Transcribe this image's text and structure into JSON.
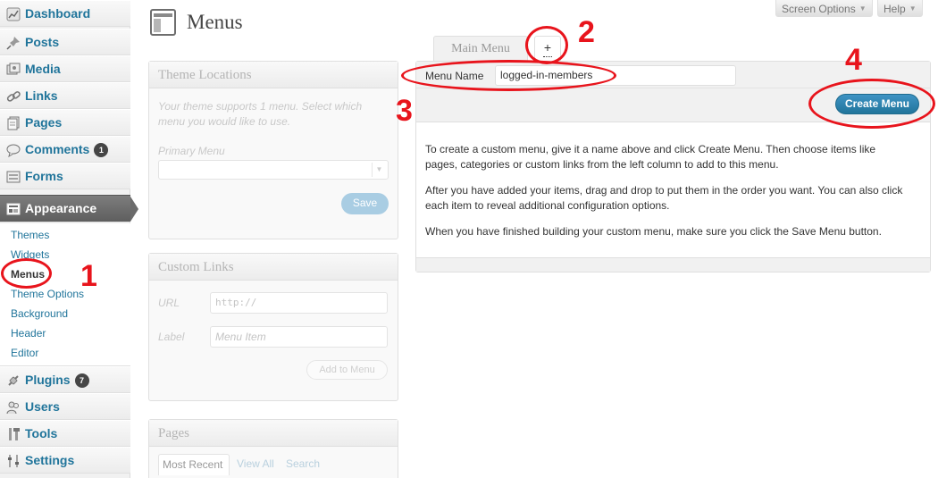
{
  "sidebar": {
    "items": [
      {
        "label": "Dashboard",
        "icon": "dashboard-icon"
      },
      {
        "label": "Posts",
        "icon": "pushpin-icon"
      },
      {
        "label": "Media",
        "icon": "media-icon"
      },
      {
        "label": "Links",
        "icon": "link-icon"
      },
      {
        "label": "Pages",
        "icon": "pages-icon"
      },
      {
        "label": "Comments",
        "icon": "comment-icon",
        "badge": "1"
      },
      {
        "label": "Forms",
        "icon": "forms-icon"
      },
      {
        "label": "Appearance",
        "icon": "appearance-icon"
      },
      {
        "label": "Plugins",
        "icon": "plugin-icon",
        "badge": "7"
      },
      {
        "label": "Users",
        "icon": "users-icon"
      },
      {
        "label": "Tools",
        "icon": "tools-icon"
      },
      {
        "label": "Settings",
        "icon": "settings-icon"
      }
    ],
    "appearance_submenu": [
      "Themes",
      "Widgets",
      "Menus",
      "Theme Options",
      "Background",
      "Header",
      "Editor"
    ],
    "current_submenu": "Menus"
  },
  "top_tabs": {
    "screen_options": "Screen Options",
    "help": "Help"
  },
  "page_title": "Menus",
  "theme_locations": {
    "title": "Theme Locations",
    "description": "Your theme supports 1 menu. Select which menu you would like to use.",
    "primary_label": "Primary Menu",
    "save_label": "Save"
  },
  "custom_links": {
    "title": "Custom Links",
    "url_label": "URL",
    "url_value": "http://",
    "label_label": "Label",
    "label_placeholder": "Menu Item",
    "add_button": "Add to Menu"
  },
  "pages_box": {
    "title": "Pages",
    "tabs": [
      "Most Recent",
      "View All",
      "Search"
    ]
  },
  "menu_tabs": {
    "main": "Main Menu",
    "add": "+"
  },
  "menu_editor": {
    "name_label": "Menu Name",
    "name_value": "logged-in-members",
    "create_button": "Create Menu",
    "instructions": [
      "To create a custom menu, give it a name above and click Create Menu. Then choose items like pages, categories or custom links from the left column to add to this menu.",
      "After you have added your items, drag and drop to put them in the order you want. You can also click each item to reveal additional configuration options.",
      "When you have finished building your custom menu, make sure you click the Save Menu button."
    ]
  },
  "annotations": [
    "1",
    "2",
    "3",
    "4"
  ],
  "colors": {
    "link": "#21759b",
    "annotation": "#e8141c",
    "button": "#21759b",
    "active_menu": "#6b6b6b"
  }
}
